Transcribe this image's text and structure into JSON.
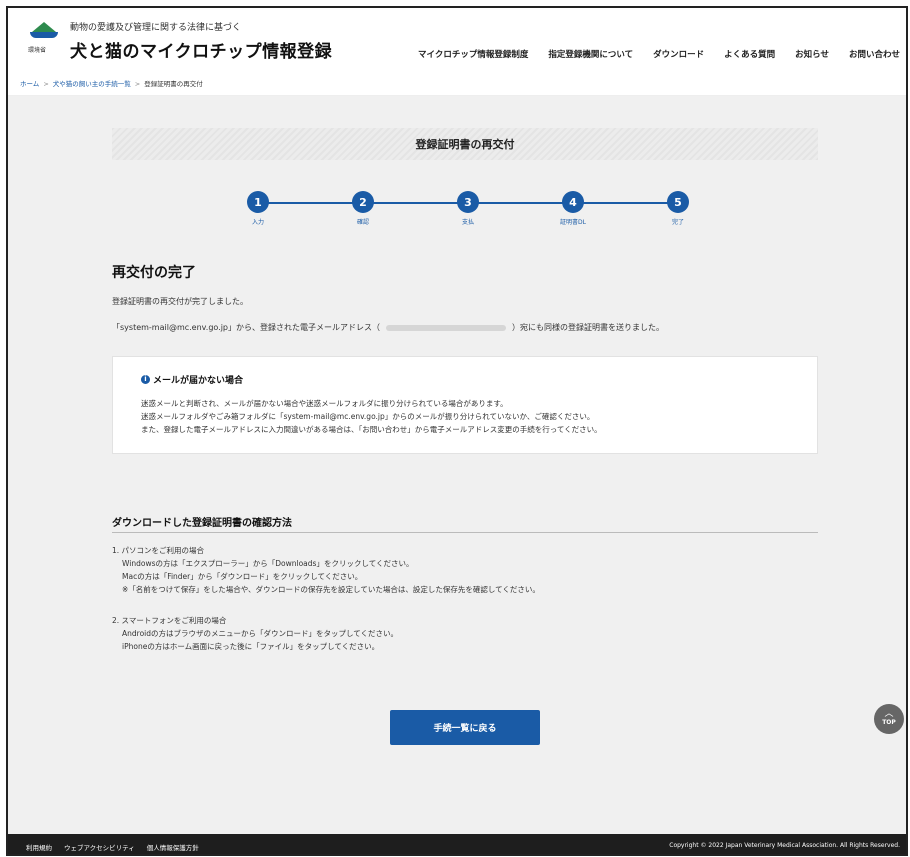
{
  "header": {
    "ministry_label": "環境省",
    "subtitle": "動物の愛護及び管理に関する法律に基づく",
    "title": "犬と猫のマイクロチップ情報登録",
    "nav": [
      "マイクロチップ情報登録制度",
      "指定登録機関について",
      "ダウンロード",
      "よくある質問",
      "お知らせ",
      "お問い合わせ"
    ]
  },
  "breadcrumb": {
    "home": "ホーム",
    "parent": "犬や猫の飼い主の手続一覧",
    "current": "登録証明書の再交付",
    "separator": ">"
  },
  "page_header": "登録証明書の再交付",
  "stepper": {
    "steps": [
      {
        "num": "1",
        "label": "入力"
      },
      {
        "num": "2",
        "label": "確認"
      },
      {
        "num": "3",
        "label": "支払"
      },
      {
        "num": "4",
        "label": "証明書DL"
      },
      {
        "num": "5",
        "label": "完了"
      }
    ]
  },
  "completion": {
    "heading": "再交付の完了",
    "message": "登録証明書の再交付が完了しました。",
    "mail_prefix": "「system-mail@mc.env.go.jp」から、登録された電子メールアドレス（",
    "mail_suffix": "）宛にも同様の登録証明書を送りました。"
  },
  "notice": {
    "icon": "info-icon",
    "title": "メールが届かない場合",
    "lines": [
      "迷惑メールと判断され、メールが届かない場合や迷惑メールフォルダに振り分けられている場合があります。",
      "迷惑メールフォルダやごみ箱フォルダに「system-mail@mc.env.go.jp」からのメールが振り分けられていないか、ご確認ください。",
      "また、登録した電子メールアドレスに入力間違いがある場合は、「お問い合わせ」から電子メールアドレス変更の手続を行ってください。"
    ]
  },
  "howto": {
    "heading": "ダウンロードした登録証明書の確認方法",
    "pc_title": "1. パソコンをご利用の場合",
    "pc_lines": [
      "Windowsの方は「エクスプローラー」から「Downloads」をクリックしてください。",
      "Macの方は「Finder」から「ダウンロード」をクリックしてください。",
      "※「名前をつけて保存」をした場合や、ダウンロードの保存先を設定していた場合は、設定した保存先を確認してください。"
    ],
    "sp_title": "2. スマートフォンをご利用の場合",
    "sp_lines": [
      "Androidの方はブラウザのメニューから「ダウンロード」をタップしてください。",
      "iPhoneの方はホーム画面に戻った後に「ファイル」をタップしてください。"
    ]
  },
  "back_button": "手続一覧に戻る",
  "top_button": {
    "arrow": "︿",
    "label": "TOP"
  },
  "footer": {
    "links": [
      "利用規約",
      "ウェブアクセシビリティ",
      "個人情報保護方針"
    ],
    "copyright": "Copyright © 2022 Japan Veterinary Medical Association. All Rights Reserved."
  },
  "colors": {
    "primary": "#1a5ba6",
    "footer_bg": "#1e1e1e",
    "main_bg": "#f0f0f0"
  }
}
